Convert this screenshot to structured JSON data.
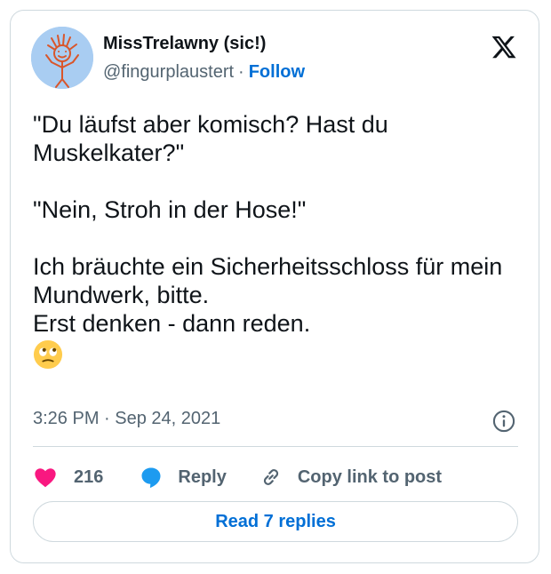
{
  "author": {
    "name": "MissTrelawny (sic!)",
    "handle": "@fingurplaustert",
    "separator": "·",
    "follow_label": "Follow"
  },
  "post": {
    "lines": [
      "\"Du läufst aber komisch? Hast du Muskelkater?\"",
      "\"Nein, Stroh in der Hose!\"",
      "Ich bräuchte ein Sicherheitsschloss für mein Mundwerk, bitte.",
      "Erst denken - dann reden."
    ],
    "emoji": "face-with-rolling-eyes"
  },
  "meta": {
    "time": "3:26 PM",
    "separator": "·",
    "date": "Sep 24, 2021"
  },
  "actions": {
    "like_count": "216",
    "reply_label": "Reply",
    "copy_label": "Copy link to post"
  },
  "replies_button": "Read 7 replies",
  "colors": {
    "accent": "#006fd6",
    "like": "#f91880",
    "reply_icon": "#1d9bf0",
    "muted": "#536471",
    "border": "#cfd9de"
  },
  "icons": [
    "x-logo-icon",
    "info-icon",
    "heart-icon",
    "reply-bubble-icon",
    "link-icon"
  ]
}
